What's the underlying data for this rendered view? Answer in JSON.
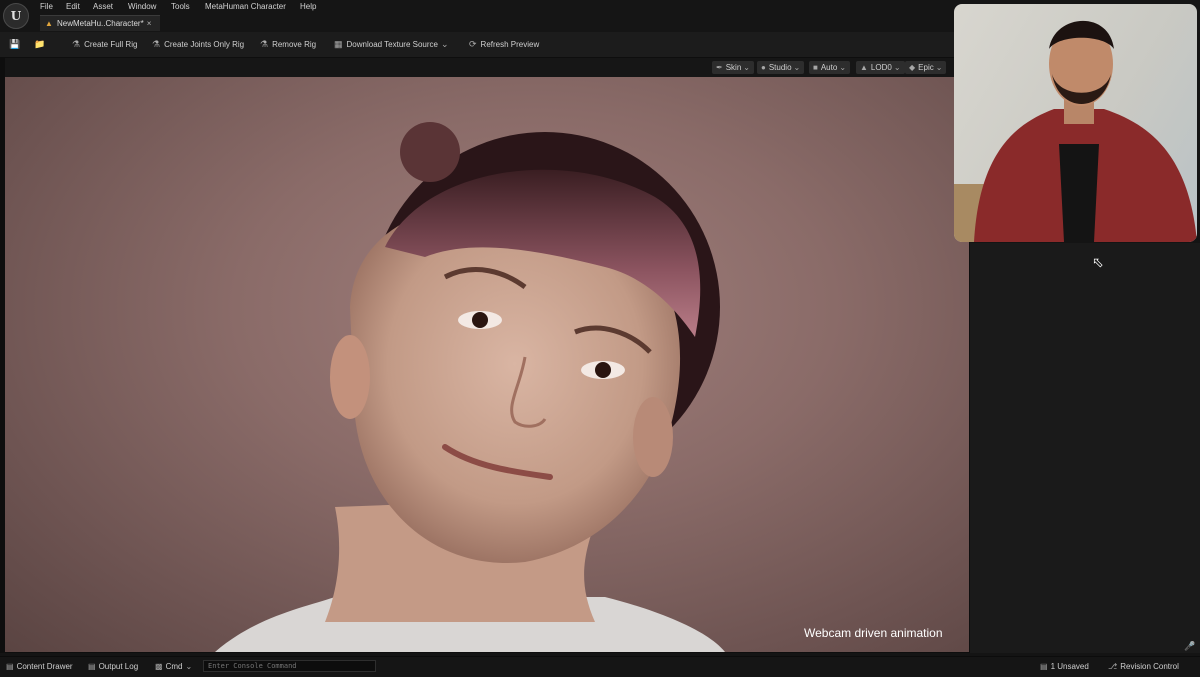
{
  "menu": {
    "items": [
      "File",
      "Edit",
      "Asset",
      "Window",
      "Tools",
      "MetaHuman Character",
      "Help"
    ]
  },
  "tab": {
    "label": "NewMetaHu..Character*",
    "close": "×"
  },
  "toolbar": {
    "create_full_rig": "Create Full Rig",
    "create_joints_only_rig": "Create Joints Only Rig",
    "remove_rig": "Remove Rig",
    "download_texture_source": "Download Texture Source",
    "refresh_preview": "Refresh Preview"
  },
  "viewport_toolbar": {
    "skin": "Skin",
    "studio": "Studio",
    "auto": "Auto",
    "lod": "LOD0",
    "quality": "Epic"
  },
  "viewport": {
    "overlay_text": "Webcam driven animation"
  },
  "statusbar": {
    "content_drawer": "Content Drawer",
    "output_log": "Output Log",
    "cmd": "Cmd",
    "console_placeholder": "Enter Console Command",
    "unsaved": "1 Unsaved",
    "revision_control": "Revision Control"
  },
  "colors": {
    "background": "#141414",
    "toolbar": "#1c1c1c",
    "tab_icon": "#e2a63d",
    "viewport_bg": "#8a6b68"
  }
}
